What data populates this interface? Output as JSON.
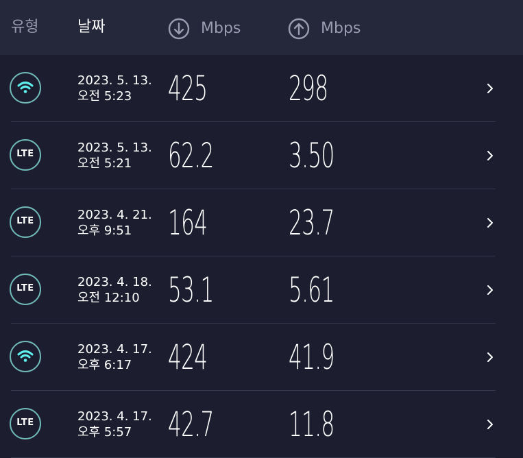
{
  "header": {
    "type_label": "유형",
    "date_label": "날짜",
    "download_unit": "Mbps",
    "upload_unit": "Mbps"
  },
  "colors": {
    "background": "#1c1d2e",
    "header_background": "#25273b",
    "accent_teal": "#6fb9b6",
    "wifi_icon": "#5ff0ee"
  },
  "results": [
    {
      "type": "wifi",
      "date": "2023. 5. 13.",
      "time": "오전 5:23",
      "download": "425",
      "upload": "298"
    },
    {
      "type": "LTE",
      "date": "2023. 5. 13.",
      "time": "오전 5:21",
      "download": "62.2",
      "upload": "3.50"
    },
    {
      "type": "LTE",
      "date": "2023. 4. 21.",
      "time": "오후 9:51",
      "download": "164",
      "upload": "23.7"
    },
    {
      "type": "LTE",
      "date": "2023. 4. 18.",
      "time": "오전 12:10",
      "download": "53.1",
      "upload": "5.61"
    },
    {
      "type": "wifi",
      "date": "2023. 4. 17.",
      "time": "오후 6:17",
      "download": "424",
      "upload": "41.9"
    },
    {
      "type": "LTE",
      "date": "2023. 4. 17.",
      "time": "오후 5:57",
      "download": "42.7",
      "upload": "11.8"
    }
  ]
}
